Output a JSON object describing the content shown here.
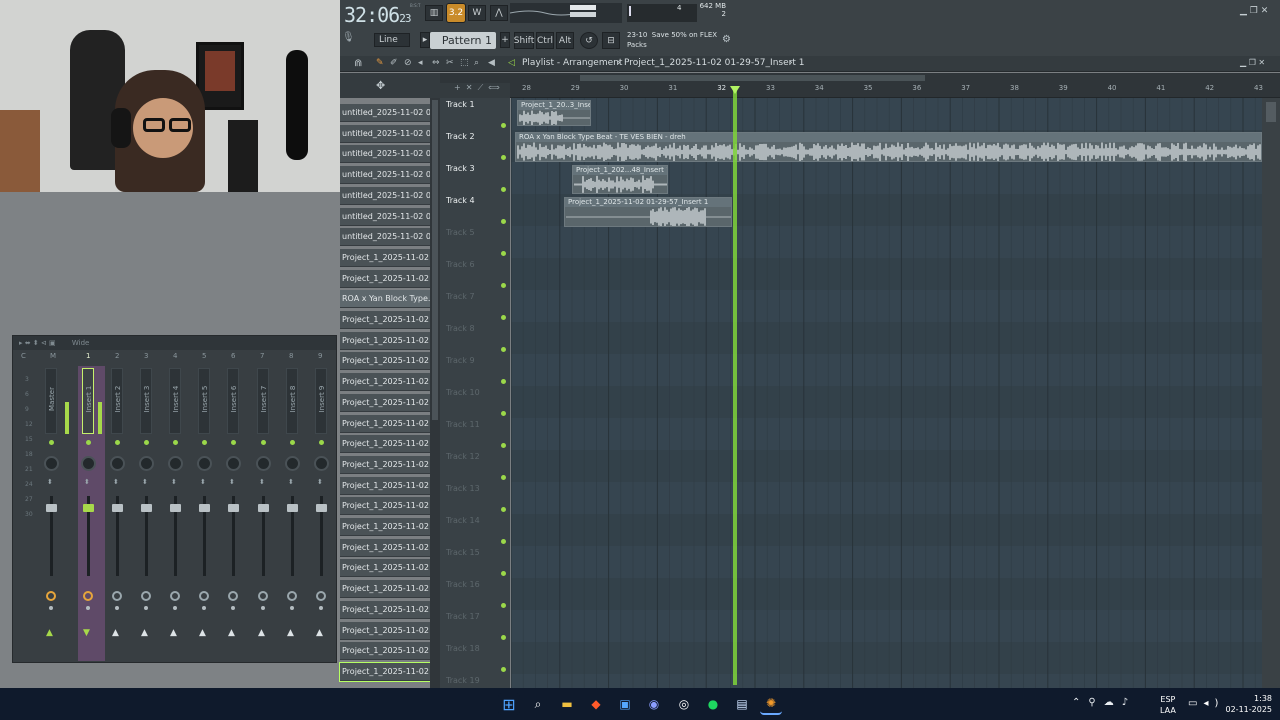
{
  "taskbar": {
    "lang": "ESP",
    "layout": "LAA",
    "time": "1:38",
    "date": "02-11-2025"
  },
  "transport": {
    "time": "32:06",
    "time_sub": "23",
    "pattern": "Pattern 1",
    "snap": "Line",
    "mem": "642 MB",
    "cpu_val": "4",
    "voices": "2",
    "modifiers": [
      "Shift",
      "Ctrl",
      "Alt"
    ],
    "news_date": "23-10",
    "news": "Save 50% on FLEX",
    "news2": "Packs",
    "bst": "B:S:T"
  },
  "playlist": {
    "title": "Playlist - Arrangement",
    "project": "Project_1_2025-11-02 01-29-57_Insert 1",
    "ruler": [
      "28",
      "29",
      "30",
      "31",
      "32",
      "33",
      "34",
      "35",
      "36",
      "37",
      "38",
      "39",
      "40",
      "41",
      "42",
      "43"
    ],
    "tracks": [
      "Track 1",
      "Track 2",
      "Track 3",
      "Track 4",
      "Track 5",
      "Track 6",
      "Track 7",
      "Track 8",
      "Track 9",
      "Track 10",
      "Track 11",
      "Track 12",
      "Track 13",
      "Track 14",
      "Track 15",
      "Track 16",
      "Track 17",
      "Track 18",
      "Track 19"
    ],
    "clips": [
      {
        "label": "Project_1_20..3_Insert 1"
      },
      {
        "label": "ROA x Yan Block Type Beat - TE VES BIEN - dreh"
      },
      {
        "label": "Project_1_202...48_Insert 1"
      },
      {
        "label": "Project_1_2025-11-02 01-29-57_Insert 1"
      }
    ]
  },
  "browser": {
    "files": [
      "untitled_2025-11-02 00-...",
      "untitled_2025-11-02 00-...",
      "untitled_2025-11-02 00-...",
      "untitled_2025-11-02 00-...",
      "untitled_2025-11-02 00-...",
      "untitled_2025-11-02 00-...",
      "untitled_2025-11-02 00-...",
      "Project_1_2025-11-02 0...",
      "Project_1_2025-11-02 0...",
      "ROA x Yan Block Type...",
      "Project_1_2025-11-02 0...",
      "Project_1_2025-11-02 0...",
      "Project_1_2025-11-02 0...",
      "Project_1_2025-11-02 0...",
      "Project_1_2025-11-02 0...",
      "Project_1_2025-11-02 0...",
      "Project_1_2025-11-02 0...",
      "Project_1_2025-11-02 0...",
      "Project_1_2025-11-02 0...",
      "Project_1_2025-11-02 0...",
      "Project_1_2025-11-02 0...",
      "Project_1_2025-11-02 0...",
      "Project_1_2025-11-02 0...",
      "Project_1_2025-11-02 0...",
      "Project_1_2025-11-02 0...",
      "Project_1_2025-11-02 0...",
      "Project_1_2025-11-02 0...",
      "Project_1_2025-11-02 0..."
    ]
  },
  "mixer": {
    "preset": "Wide",
    "header": [
      "C",
      "M",
      "1",
      "2",
      "3",
      "4",
      "5",
      "6",
      "7",
      "8",
      "9"
    ],
    "channels": [
      "Master",
      "Insert 1",
      "Insert 2",
      "Insert 3",
      "Insert 4",
      "Insert 5",
      "Insert 6",
      "Insert 7",
      "Insert 8",
      "Insert 9"
    ],
    "scale": [
      "3",
      "6",
      "9",
      "12",
      "15",
      "18",
      "21",
      "24",
      "27",
      "30"
    ]
  }
}
